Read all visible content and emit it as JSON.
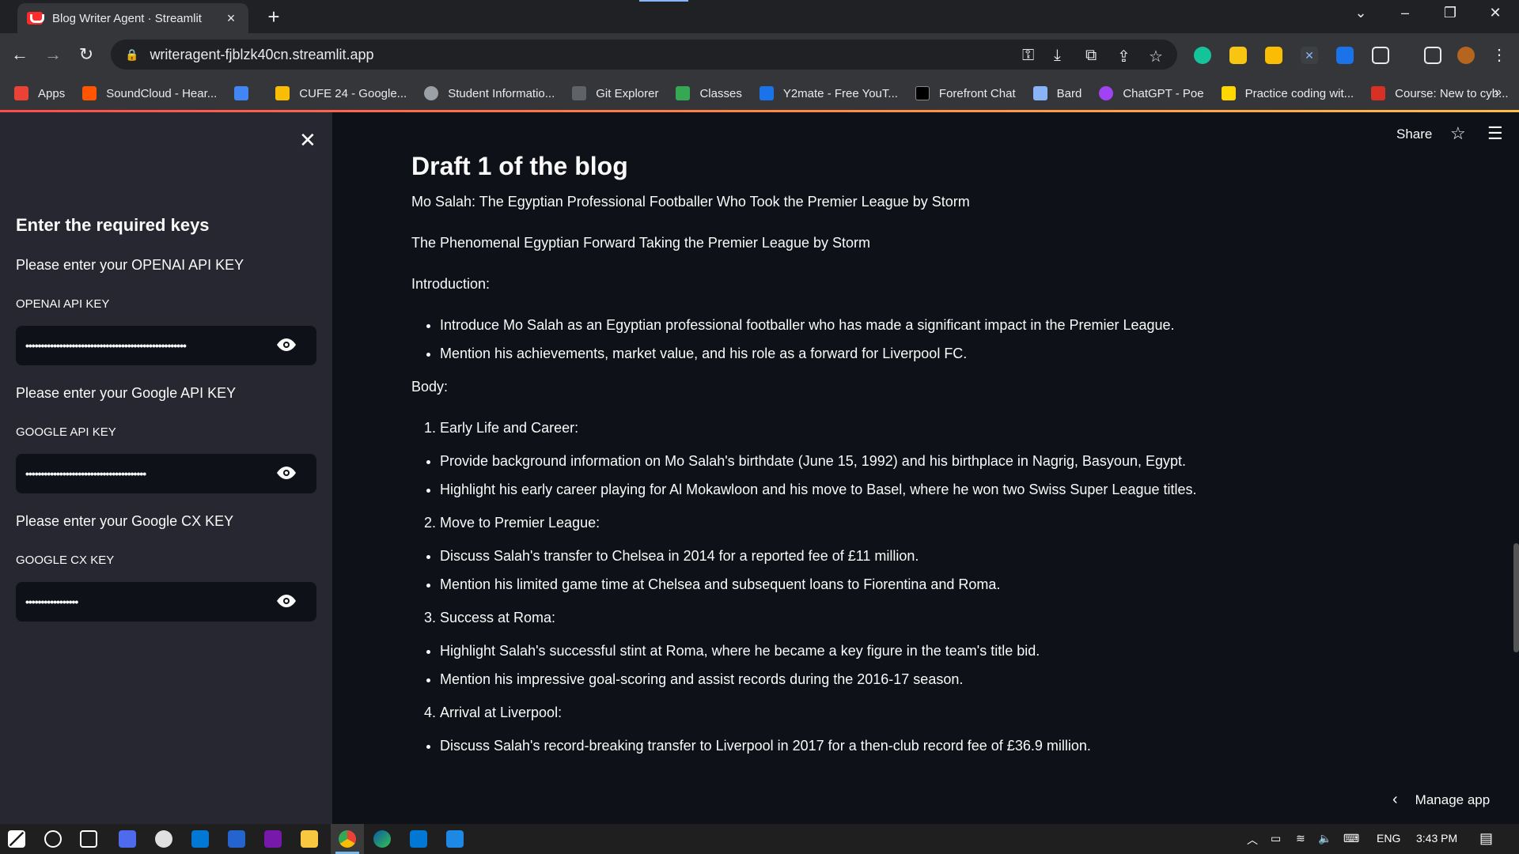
{
  "browser": {
    "tab_title": "Blog Writer Agent · Streamlit",
    "url": "writeragent-fjblzk40cn.streamlit.app",
    "bookmarks": [
      {
        "label": "Apps",
        "color": "#ea4335"
      },
      {
        "label": "SoundCloud - Hear...",
        "color": "#ff5500"
      },
      {
        "label": "",
        "color": "#4285f4"
      },
      {
        "label": "CUFE 24 - Google...",
        "color": "#fbbc04"
      },
      {
        "label": "Student Informatio...",
        "color": "#9aa0a6"
      },
      {
        "label": "Git Explorer",
        "color": "#9aa0a6"
      },
      {
        "label": "Classes",
        "color": "#34a853"
      },
      {
        "label": "Y2mate - Free YouT...",
        "color": "#1a73e8"
      },
      {
        "label": "Forefront Chat",
        "color": "#000000"
      },
      {
        "label": "Bard",
        "color": "#8ab4f8"
      },
      {
        "label": "ChatGPT - Poe",
        "color": "#a142f4"
      },
      {
        "label": "Practice coding wit...",
        "color": "#ffd600"
      },
      {
        "label": "Course: New to cyb...",
        "color": "#d93025"
      }
    ],
    "more": "»"
  },
  "sidebar": {
    "close": "✕",
    "heading": "Enter the required keys",
    "openai_prompt": "Please enter your OPENAI API KEY",
    "openai_label": "OPENAI API KEY",
    "openai_value": "••••••••••••••••••••••••••••••••••••••••••••••••••••",
    "google_prompt": "Please enter your Google API KEY",
    "google_label": "GOOGLE API KEY",
    "google_value": "•••••••••••••••••••••••••••••••••••••••",
    "cx_prompt": "Please enter your Google CX KEY",
    "cx_label": "GOOGLE CX KEY",
    "cx_value": "•••••••••••••••••"
  },
  "header": {
    "share": "Share",
    "star": "☆",
    "menu": "☰"
  },
  "main": {
    "title": "Draft 1 of the blog",
    "line1": "Mo Salah: The Egyptian Professional Footballer Who Took the Premier League by Storm",
    "line2": "The Phenomenal Egyptian Forward Taking the Premier League by Storm",
    "intro": "Introduction:",
    "intro_items": [
      "Introduce Mo Salah as an Egyptian professional footballer who has made a significant impact in the Premier League.",
      "Mention his achievements, market value, and his role as a forward for Liverpool FC."
    ],
    "body": "Body:",
    "sec1": "Early Life and Career:",
    "sec1_items": [
      "Provide background information on Mo Salah's birthdate (June 15, 1992) and his birthplace in Nagrig, Basyoun, Egypt.",
      "Highlight his early career playing for Al Mokawloon and his move to Basel, where he won two Swiss Super League titles."
    ],
    "sec2": "Move to Premier League:",
    "sec2_items": [
      "Discuss Salah's transfer to Chelsea in 2014 for a reported fee of £11 million.",
      "Mention his limited game time at Chelsea and subsequent loans to Fiorentina and Roma."
    ],
    "sec3": "Success at Roma:",
    "sec3_items": [
      "Highlight Salah's successful stint at Roma, where he became a key figure in the team's title bid.",
      "Mention his impressive goal-scoring and assist records during the 2016-17 season."
    ],
    "sec4": "Arrival at Liverpool:",
    "sec4_items": [
      "Discuss Salah's record-breaking transfer to Liverpool in 2017 for a then-club record fee of £36.9 million."
    ],
    "manage_app": "Manage app"
  },
  "taskbar": {
    "lang": "ENG",
    "time": "3:43 PM"
  }
}
